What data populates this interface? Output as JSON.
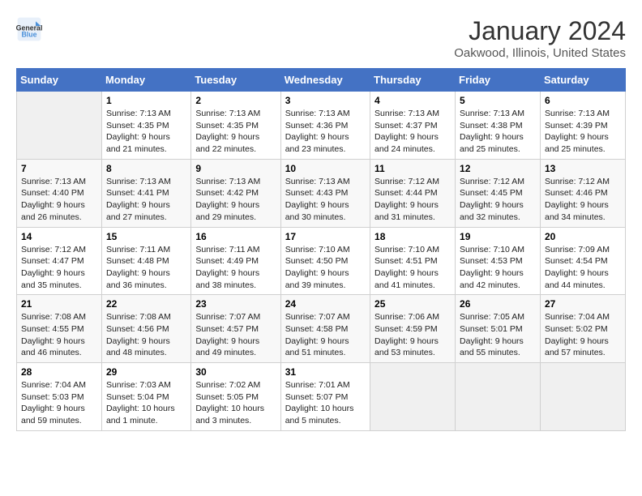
{
  "header": {
    "logo_line1": "General",
    "logo_line2": "Blue",
    "title": "January 2024",
    "subtitle": "Oakwood, Illinois, United States"
  },
  "columns": [
    "Sunday",
    "Monday",
    "Tuesday",
    "Wednesday",
    "Thursday",
    "Friday",
    "Saturday"
  ],
  "weeks": [
    [
      {
        "day": "",
        "info": ""
      },
      {
        "day": "1",
        "info": "Sunrise: 7:13 AM\nSunset: 4:35 PM\nDaylight: 9 hours\nand 21 minutes."
      },
      {
        "day": "2",
        "info": "Sunrise: 7:13 AM\nSunset: 4:35 PM\nDaylight: 9 hours\nand 22 minutes."
      },
      {
        "day": "3",
        "info": "Sunrise: 7:13 AM\nSunset: 4:36 PM\nDaylight: 9 hours\nand 23 minutes."
      },
      {
        "day": "4",
        "info": "Sunrise: 7:13 AM\nSunset: 4:37 PM\nDaylight: 9 hours\nand 24 minutes."
      },
      {
        "day": "5",
        "info": "Sunrise: 7:13 AM\nSunset: 4:38 PM\nDaylight: 9 hours\nand 25 minutes."
      },
      {
        "day": "6",
        "info": "Sunrise: 7:13 AM\nSunset: 4:39 PM\nDaylight: 9 hours\nand 25 minutes."
      }
    ],
    [
      {
        "day": "7",
        "info": "Sunrise: 7:13 AM\nSunset: 4:40 PM\nDaylight: 9 hours\nand 26 minutes."
      },
      {
        "day": "8",
        "info": "Sunrise: 7:13 AM\nSunset: 4:41 PM\nDaylight: 9 hours\nand 27 minutes."
      },
      {
        "day": "9",
        "info": "Sunrise: 7:13 AM\nSunset: 4:42 PM\nDaylight: 9 hours\nand 29 minutes."
      },
      {
        "day": "10",
        "info": "Sunrise: 7:13 AM\nSunset: 4:43 PM\nDaylight: 9 hours\nand 30 minutes."
      },
      {
        "day": "11",
        "info": "Sunrise: 7:12 AM\nSunset: 4:44 PM\nDaylight: 9 hours\nand 31 minutes."
      },
      {
        "day": "12",
        "info": "Sunrise: 7:12 AM\nSunset: 4:45 PM\nDaylight: 9 hours\nand 32 minutes."
      },
      {
        "day": "13",
        "info": "Sunrise: 7:12 AM\nSunset: 4:46 PM\nDaylight: 9 hours\nand 34 minutes."
      }
    ],
    [
      {
        "day": "14",
        "info": "Sunrise: 7:12 AM\nSunset: 4:47 PM\nDaylight: 9 hours\nand 35 minutes."
      },
      {
        "day": "15",
        "info": "Sunrise: 7:11 AM\nSunset: 4:48 PM\nDaylight: 9 hours\nand 36 minutes."
      },
      {
        "day": "16",
        "info": "Sunrise: 7:11 AM\nSunset: 4:49 PM\nDaylight: 9 hours\nand 38 minutes."
      },
      {
        "day": "17",
        "info": "Sunrise: 7:10 AM\nSunset: 4:50 PM\nDaylight: 9 hours\nand 39 minutes."
      },
      {
        "day": "18",
        "info": "Sunrise: 7:10 AM\nSunset: 4:51 PM\nDaylight: 9 hours\nand 41 minutes."
      },
      {
        "day": "19",
        "info": "Sunrise: 7:10 AM\nSunset: 4:53 PM\nDaylight: 9 hours\nand 42 minutes."
      },
      {
        "day": "20",
        "info": "Sunrise: 7:09 AM\nSunset: 4:54 PM\nDaylight: 9 hours\nand 44 minutes."
      }
    ],
    [
      {
        "day": "21",
        "info": "Sunrise: 7:08 AM\nSunset: 4:55 PM\nDaylight: 9 hours\nand 46 minutes."
      },
      {
        "day": "22",
        "info": "Sunrise: 7:08 AM\nSunset: 4:56 PM\nDaylight: 9 hours\nand 48 minutes."
      },
      {
        "day": "23",
        "info": "Sunrise: 7:07 AM\nSunset: 4:57 PM\nDaylight: 9 hours\nand 49 minutes."
      },
      {
        "day": "24",
        "info": "Sunrise: 7:07 AM\nSunset: 4:58 PM\nDaylight: 9 hours\nand 51 minutes."
      },
      {
        "day": "25",
        "info": "Sunrise: 7:06 AM\nSunset: 4:59 PM\nDaylight: 9 hours\nand 53 minutes."
      },
      {
        "day": "26",
        "info": "Sunrise: 7:05 AM\nSunset: 5:01 PM\nDaylight: 9 hours\nand 55 minutes."
      },
      {
        "day": "27",
        "info": "Sunrise: 7:04 AM\nSunset: 5:02 PM\nDaylight: 9 hours\nand 57 minutes."
      }
    ],
    [
      {
        "day": "28",
        "info": "Sunrise: 7:04 AM\nSunset: 5:03 PM\nDaylight: 9 hours\nand 59 minutes."
      },
      {
        "day": "29",
        "info": "Sunrise: 7:03 AM\nSunset: 5:04 PM\nDaylight: 10 hours\nand 1 minute."
      },
      {
        "day": "30",
        "info": "Sunrise: 7:02 AM\nSunset: 5:05 PM\nDaylight: 10 hours\nand 3 minutes."
      },
      {
        "day": "31",
        "info": "Sunrise: 7:01 AM\nSunset: 5:07 PM\nDaylight: 10 hours\nand 5 minutes."
      },
      {
        "day": "",
        "info": ""
      },
      {
        "day": "",
        "info": ""
      },
      {
        "day": "",
        "info": ""
      }
    ]
  ]
}
